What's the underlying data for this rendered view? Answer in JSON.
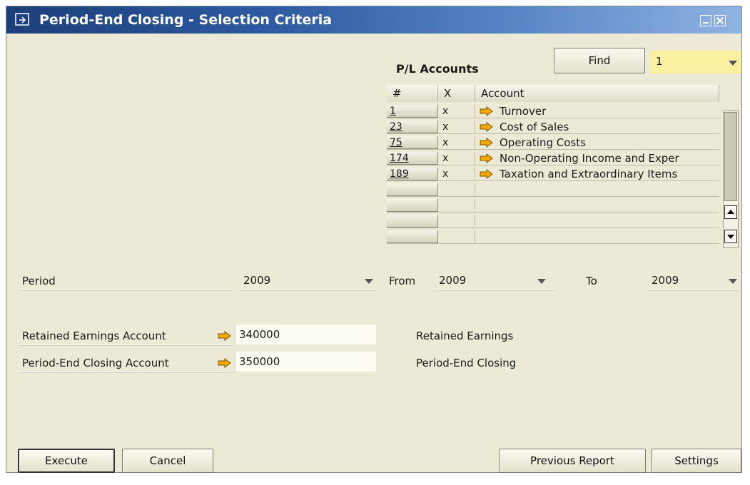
{
  "window": {
    "title": "Period-End Closing - Selection Criteria"
  },
  "pl_accounts": {
    "heading": "P/L Accounts",
    "find_label": "Find",
    "find_value": "1",
    "columns": [
      "#",
      "X",
      "Account"
    ],
    "rows": [
      {
        "num": "1",
        "x": "x",
        "account": "Turnover"
      },
      {
        "num": "23",
        "x": "x",
        "account": "Cost of Sales"
      },
      {
        "num": "75",
        "x": "x",
        "account": "Operating Costs"
      },
      {
        "num": "174",
        "x": "x",
        "account": "Non-Operating Income and Exper"
      },
      {
        "num": "189",
        "x": "x",
        "account": "Taxation and Extraordinary Items"
      },
      {
        "num": "",
        "x": "",
        "account": ""
      },
      {
        "num": "",
        "x": "",
        "account": ""
      },
      {
        "num": "",
        "x": "",
        "account": ""
      },
      {
        "num": "",
        "x": "",
        "account": ""
      }
    ]
  },
  "period": {
    "label": "Period",
    "value": "2009",
    "from_label": "From",
    "from_value": "2009",
    "to_label": "To",
    "to_value": "2009"
  },
  "accounts": {
    "retained_label": "Retained Earnings Account",
    "retained_value": "340000",
    "retained_name": "Retained Earnings",
    "closing_label": "Period-End Closing Account",
    "closing_value": "350000",
    "closing_name": "Period-End Closing"
  },
  "buttons": {
    "execute": "Execute",
    "cancel": "Cancel",
    "previous_report": "Previous Report",
    "settings": "Settings"
  },
  "colors": {
    "window_bg": "#ecead6",
    "link_arrow": "#f5a800",
    "find_field": "#fbf0a0"
  }
}
